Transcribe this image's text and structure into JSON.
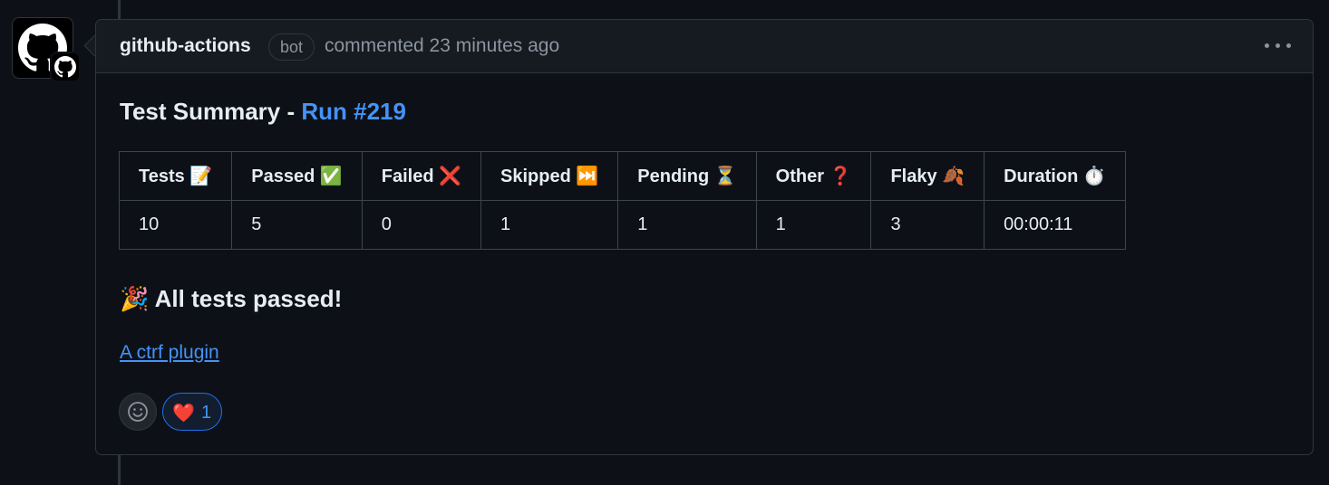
{
  "comment": {
    "author": "github-actions",
    "badge": "bot",
    "meta": "commented 23 minutes ago",
    "more_icon": "kebab-horizontal-icon"
  },
  "body": {
    "title_prefix": "Test Summary - ",
    "run_link": "Run #219",
    "table": {
      "headers": [
        "Tests 📝",
        "Passed ✅",
        "Failed ❌",
        "Skipped ⏭️",
        "Pending ⏳",
        "Other ❓",
        "Flaky 🍂",
        "Duration ⏱️"
      ],
      "row": [
        "10",
        "5",
        "0",
        "1",
        "1",
        "1",
        "3",
        "00:00:11"
      ]
    },
    "result": "🎉 All tests passed!",
    "plugin_link": "A ctrf plugin"
  },
  "reactions": {
    "add_icon": "smiley-icon",
    "items": [
      {
        "emoji": "❤️",
        "count": "1"
      }
    ]
  },
  "colors": {
    "background": "#0d1117",
    "header_bg": "#161b22",
    "border": "#30363d",
    "link": "#4493f8",
    "muted_text": "#8b949e"
  }
}
